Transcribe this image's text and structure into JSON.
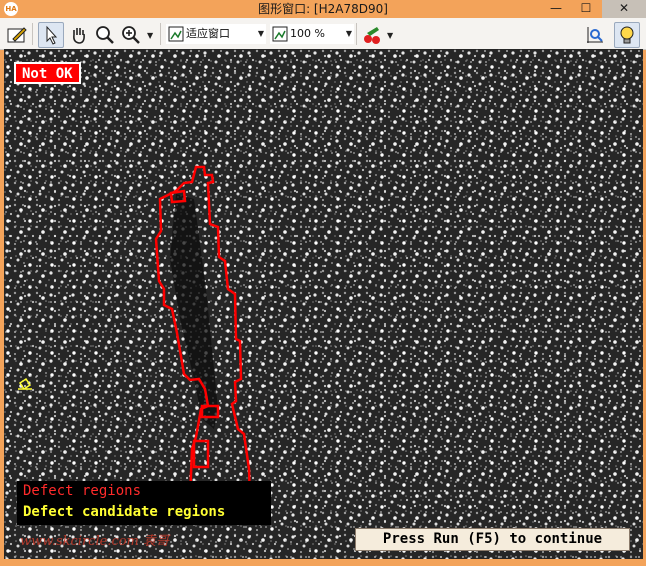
{
  "window": {
    "app_icon": "HA",
    "title": "图形窗口: [H2A78D90]",
    "minimize_glyph": "—",
    "maximize_glyph": "☐",
    "close_glyph": "✕"
  },
  "toolbar": {
    "fit_mode": "适应窗口",
    "zoom_level": "100 %"
  },
  "overlay": {
    "status_text": "Not OK",
    "legend": [
      "Defect regions",
      "Defect candidate regions"
    ],
    "watermark": "www.skcircle.com 袁哥",
    "continue_prompt": "Press Run (F5) to continue"
  },
  "colors": {
    "titlebar": "#f3a35a",
    "defect_region": "#ff0000",
    "candidate_region": "#ffff33",
    "status_bg": "#ff0000"
  }
}
